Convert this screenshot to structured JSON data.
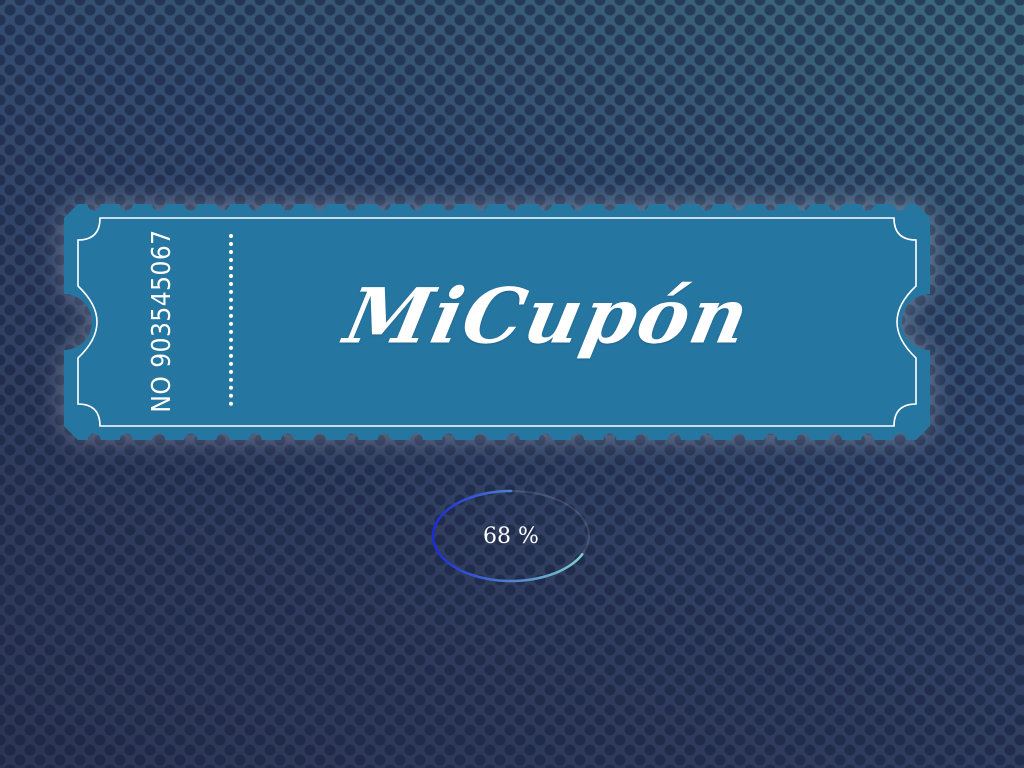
{
  "coupon": {
    "brand": "MiCupón",
    "serial": "NO 903545067",
    "ticket_color": "#2676a2",
    "border_color": "#ffffff"
  },
  "progress": {
    "label": "68 %",
    "value": 0.68,
    "gradient_start": "#7fd1c8",
    "gradient_end": "#1b2bd6"
  },
  "background": {
    "color_top": "#3d6a7e",
    "color_bottom": "#2c3553"
  }
}
